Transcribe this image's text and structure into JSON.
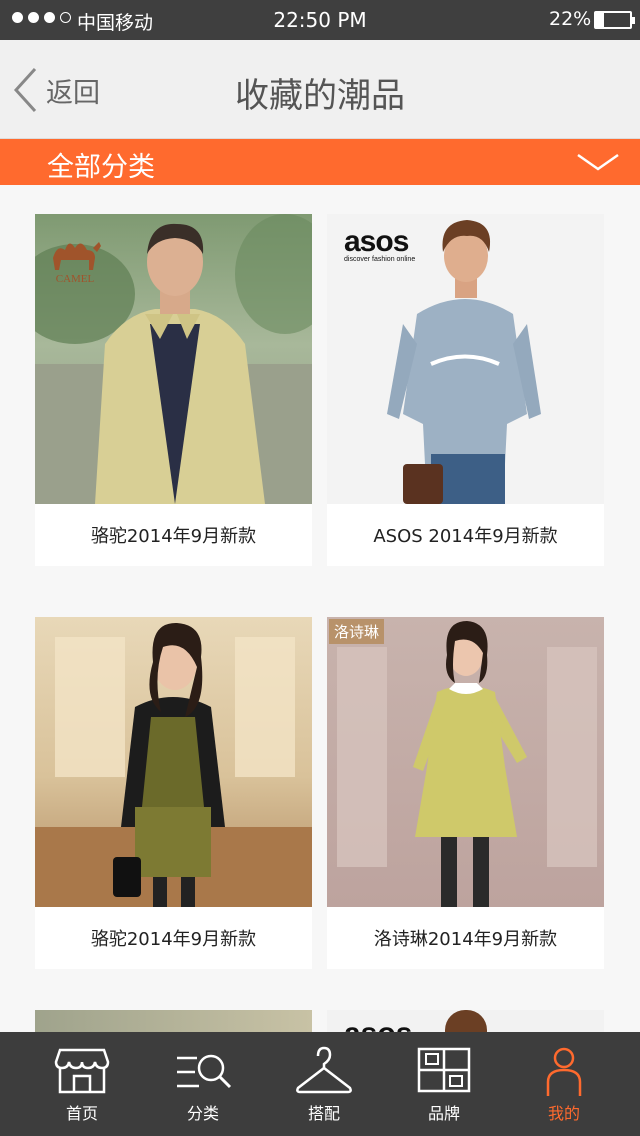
{
  "status_bar": {
    "carrier": "中国移动",
    "time": "22:50 PM",
    "battery": "22%",
    "battery_level": 0.22,
    "signal_bars": 3
  },
  "nav": {
    "back_label": "返回",
    "title": "收藏的潮品",
    "back_icon": "chevron-left-icon"
  },
  "category_bar": {
    "label": "全部分类",
    "icon": "chevron-down-icon",
    "color": "#ff6a2e"
  },
  "products": [
    {
      "caption": "骆驼2014年9月新款",
      "brand_logo": "CAMEL"
    },
    {
      "caption": "ASOS 2014年9月新款",
      "brand_logo": "asos",
      "brand_tagline": "discover fashion online"
    },
    {
      "caption": "骆驼2014年9月新款"
    },
    {
      "caption": "洛诗琳2014年9月新款",
      "brand_logo": "洛诗琳"
    }
  ],
  "tabs": [
    {
      "label": "首页",
      "icon": "store-icon"
    },
    {
      "label": "分类",
      "icon": "search-list-icon"
    },
    {
      "label": "搭配",
      "icon": "hanger-icon"
    },
    {
      "label": "品牌",
      "icon": "brand-grid-icon"
    },
    {
      "label": "我的",
      "icon": "person-icon",
      "active": true
    }
  ]
}
